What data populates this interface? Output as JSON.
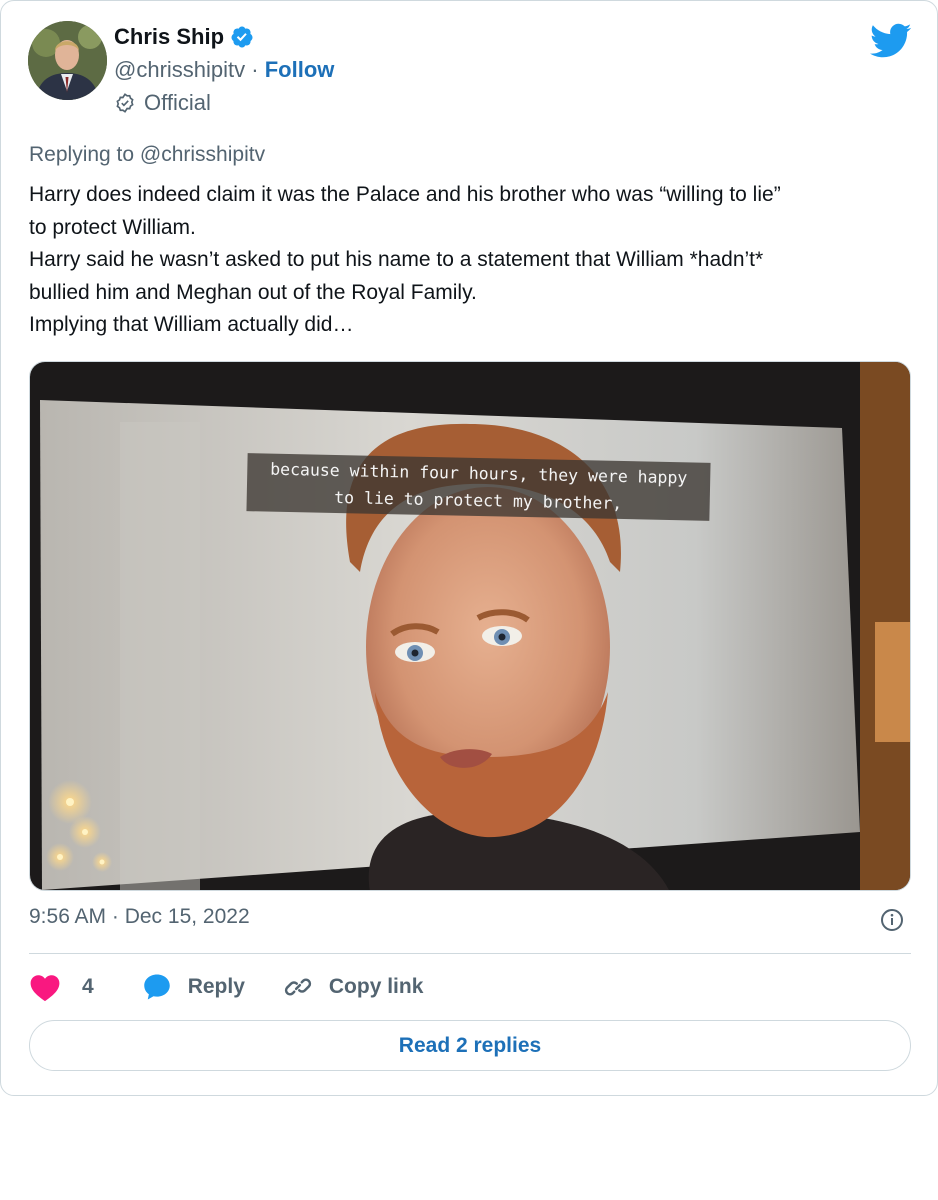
{
  "author": {
    "display_name": "Chris Ship",
    "handle": "@chrisshipitv",
    "separator": "·",
    "follow_label": "Follow",
    "badge_label": "Official",
    "verified_color": "#1d9bf0"
  },
  "tweet": {
    "replying_to_prefix": "Replying to",
    "replying_to_handle": "@chrisshipitv",
    "lines": [
      "Harry does indeed claim it was the Palace and his brother who was “willing to lie”",
      "to protect William.",
      "Harry said he wasn’t asked to put his name to a statement that William *hadn’t*",
      "bullied him and Meghan out of the Royal Family.",
      "Implying that William actually did…"
    ],
    "media": {
      "caption_line1": "because within four hours, they were happy",
      "caption_line2": "to lie to protect my brother,"
    },
    "timestamp": "9:56 AM · Dec 15, 2022"
  },
  "actions": {
    "like_count": "4",
    "reply_label": "Reply",
    "copy_link_label": "Copy link",
    "read_replies_label": "Read 2 replies"
  },
  "icons": {
    "brand": "twitter-bird-icon",
    "like": "heart-icon",
    "reply": "speech-bubble-icon",
    "copy": "link-icon",
    "info": "info-icon",
    "official": "official-badge-icon"
  },
  "colors": {
    "brand_blue": "#1d9bf0",
    "link_blue": "#1d70b8",
    "heart_pink": "#f91880",
    "muted_text": "#536471"
  }
}
